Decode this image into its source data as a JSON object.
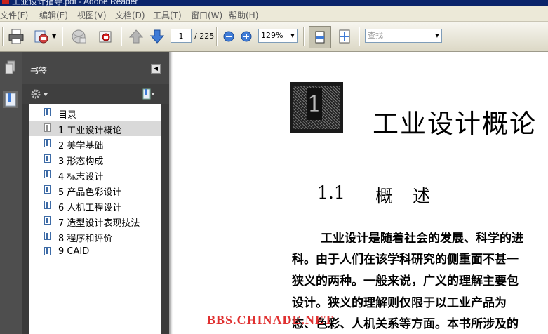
{
  "window": {
    "title": "工业设计指导.pdf - Adobe Reader"
  },
  "menu": [
    "文件(F)",
    "编辑(E)",
    "视图(V)",
    "文档(D)",
    "工具(T)",
    "窗口(W)",
    "帮助(H)"
  ],
  "toolbar": {
    "page_current": "1",
    "page_total": "/ 225",
    "zoom": "129%",
    "search_placeholder": "查找",
    "icons": [
      "print-icon",
      "email-icon",
      "globe-icon",
      "secure-icon",
      "previous-page-icon",
      "next-page-icon",
      "zoom-out-icon",
      "zoom-in-icon",
      "single-page-view-icon",
      "fit-page-icon"
    ]
  },
  "panel": {
    "title": "书签",
    "bookmarks": [
      {
        "label": "目录"
      },
      {
        "label": "1 工业设计概论",
        "selected": true
      },
      {
        "label": "2 美学基础"
      },
      {
        "label": "3 形态构成"
      },
      {
        "label": "4 标志设计"
      },
      {
        "label": "5 产品色彩设计"
      },
      {
        "label": "6 人机工程设计"
      },
      {
        "label": "7 造型设计表现技法"
      },
      {
        "label": "8 程序和评价"
      },
      {
        "label": "9 CAID"
      }
    ]
  },
  "document": {
    "chapter_number": "1",
    "chapter_title": "工业设计概论",
    "section_number": "1.1",
    "section_title": "概述",
    "paragraph_lines": [
      "工业设计是随着社会的发展、科学的进",
      "科。由于人们在该学科研究的侧重面不甚一",
      "狭义的两种。一般来说，广义的理解主要包",
      "设计。狭义的理解则仅限于以工业产品为",
      "态、色彩、人机关系等方面。本书所涉及的"
    ],
    "watermark": "BBS.CHINADE.NET"
  },
  "colors": {
    "titlebar": "#0a246a",
    "panel_bg": "#3a3a3a",
    "watermark": "#e03030"
  }
}
